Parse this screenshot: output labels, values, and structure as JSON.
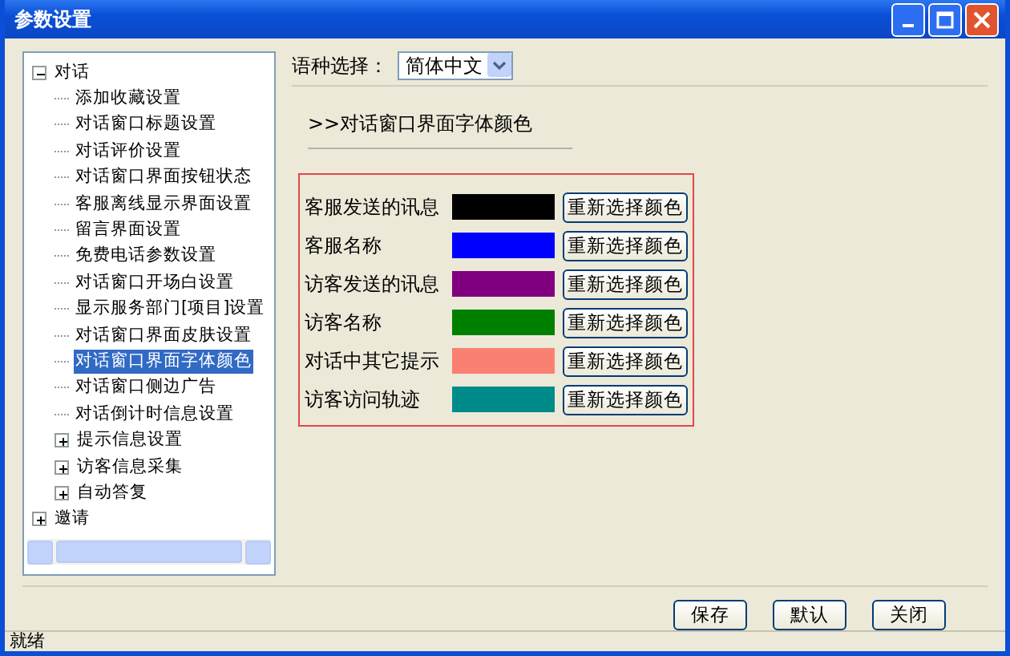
{
  "window": {
    "title": "参数设置"
  },
  "tree": [
    {
      "label": "对话",
      "selected": false,
      "expanded": true,
      "children": [
        {
          "label": "添加收藏设置",
          "selected": false
        },
        {
          "label": "对话窗口标题设置",
          "selected": false
        },
        {
          "label": "对话评价设置",
          "selected": false
        },
        {
          "label": "对话窗口界面按钮状态",
          "selected": false
        },
        {
          "label": "客服离线显示界面设置",
          "selected": false
        },
        {
          "label": "留言界面设置",
          "selected": false
        },
        {
          "label": "免费电话参数设置",
          "selected": false
        },
        {
          "label": "对话窗口开场白设置",
          "selected": false
        },
        {
          "label": "显示服务部门[项目]设置",
          "selected": false
        },
        {
          "label": "对话窗口界面皮肤设置",
          "selected": false
        },
        {
          "label": "对话窗口界面字体颜色",
          "selected": true
        },
        {
          "label": "对话窗口侧边广告",
          "selected": false
        },
        {
          "label": "对话倒计时信息设置",
          "selected": false
        },
        {
          "label": "提示信息设置",
          "selected": false,
          "expanded": false
        },
        {
          "label": "访客信息采集",
          "selected": false,
          "expanded": false
        },
        {
          "label": "自动答复",
          "selected": false,
          "expanded": false
        }
      ]
    },
    {
      "label": "邀请",
      "selected": false,
      "expanded": false
    }
  ],
  "language": {
    "label": "语种选择：",
    "value": "简体中文"
  },
  "section_title": ">>对话窗口界面字体颜色",
  "colors": [
    {
      "label": "客服发送的讯息",
      "color": "#000000",
      "button": "重新选择颜色"
    },
    {
      "label": "客服名称",
      "color": "#0000ff",
      "button": "重新选择颜色"
    },
    {
      "label": "访客发送的讯息",
      "color": "#800080",
      "button": "重新选择颜色"
    },
    {
      "label": "访客名称",
      "color": "#008000",
      "button": "重新选择颜色"
    },
    {
      "label": "对话中其它提示",
      "color": "#fa8072",
      "button": "重新选择颜色"
    },
    {
      "label": "访客访问轨迹",
      "color": "#008b8b",
      "button": "重新选择颜色"
    }
  ],
  "buttons": [
    "保存",
    "默认",
    "关闭"
  ],
  "status_bar": "就绪"
}
